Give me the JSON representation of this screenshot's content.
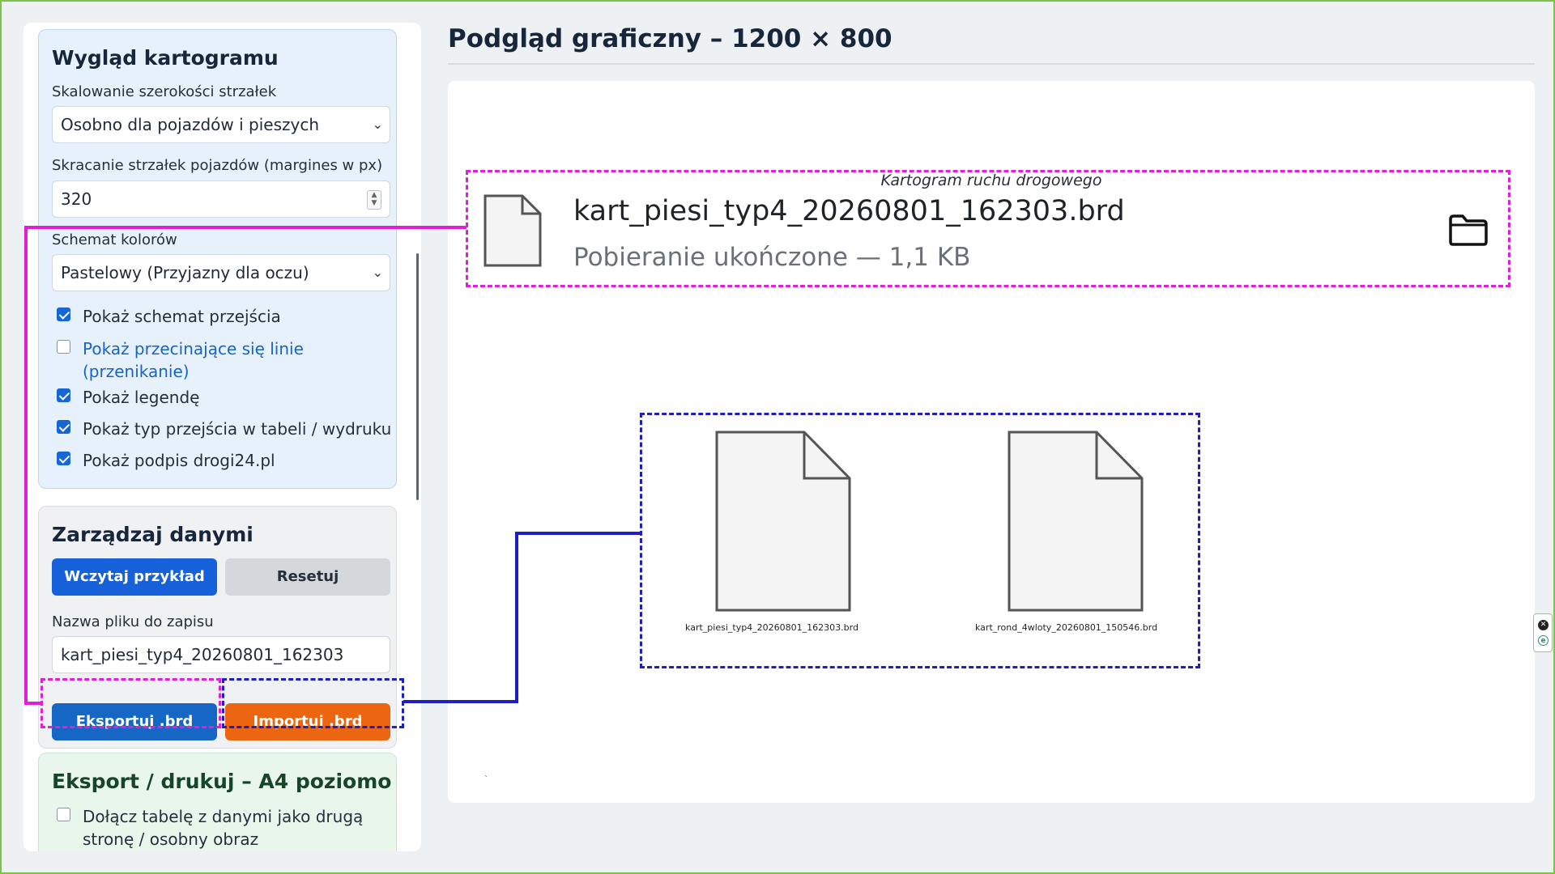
{
  "sidebar": {
    "appearance": {
      "title": "Wygląd kartogramu",
      "scaling_label": "Skalowanie szerokości strzałek",
      "scaling_value": "Osobno dla pojazdów i pieszych",
      "shorten_label": "Skracanie strzałek pojazdów (margines w px)",
      "shorten_value": "320",
      "scheme_label": "Schemat kolorów",
      "scheme_value": "Pastelowy (Przyjazny dla oczu)",
      "checkboxes": [
        {
          "label": "Pokaż schemat przejścia",
          "checked": true
        },
        {
          "label": "Pokaż przecinające się linie",
          "label2": "(przenikanie)",
          "checked": false
        },
        {
          "label": "Pokaż legendę",
          "checked": true
        },
        {
          "label": "Pokaż typ przejścia w tabeli / wydruku",
          "checked": true
        },
        {
          "label": "Pokaż podpis drogi24.pl",
          "checked": true
        }
      ]
    },
    "data": {
      "title": "Zarządzaj danymi",
      "load_example": "Wczytaj przykład",
      "reset": "Resetuj",
      "filename_label": "Nazwa pliku do zapisu",
      "filename_value": "kart_piesi_typ4_20260801_162303",
      "export_button": "Eksportuj .brd",
      "import_button": "Importuj .brd"
    },
    "export": {
      "title": "Eksport / drukuj – A4 poziomo",
      "attach_table_label": "Dołącz tabelę z danymi jako drugą",
      "attach_table_label2": "stronę / osobny obraz",
      "attach_table_checked": false
    }
  },
  "main": {
    "title": "Podgląd graficzny – 1200 × 800",
    "canvas_caption": "Kartogram ruchu drogowego"
  },
  "download": {
    "filename": "kart_piesi_typ4_20260801_162303.brd",
    "status": "Pobieranie ukończone — 1,1 KB"
  },
  "files": [
    {
      "name": "kart_piesi_typ4_20260801_162303.brd"
    },
    {
      "name": "kart_rond_4wloty_20260801_150546.brd"
    }
  ],
  "colors": {
    "magenta_annotation": "#e020d4",
    "blue_annotation": "#1f1fbf",
    "primary": "#1661d9",
    "import_orange": "#ec6511"
  }
}
